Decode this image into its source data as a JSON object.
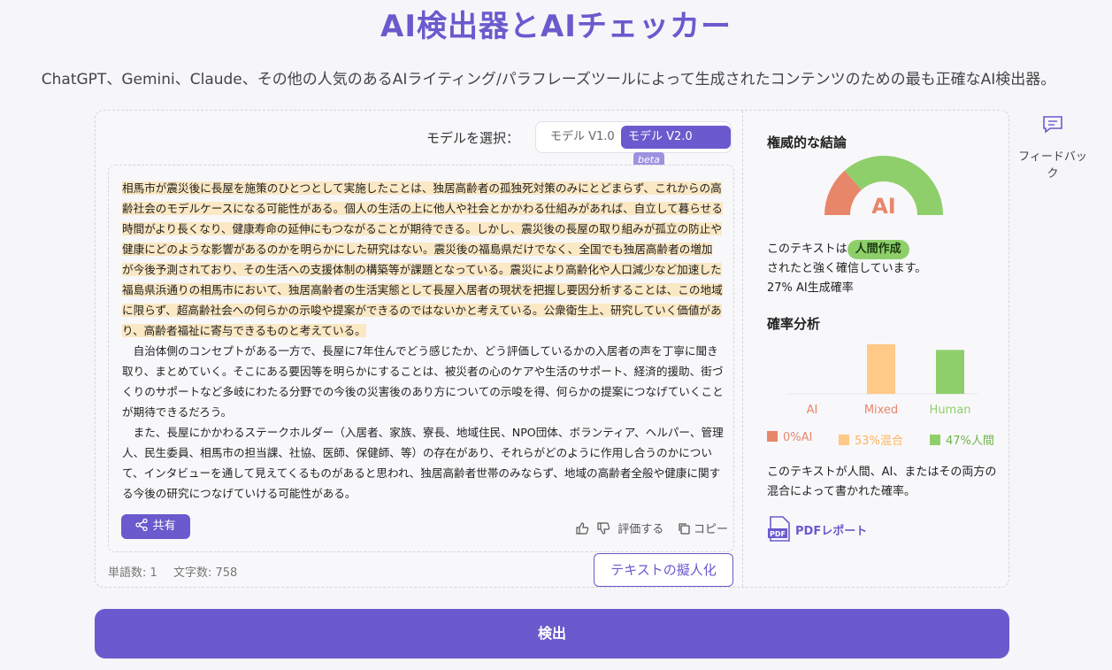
{
  "header": {
    "title": "AI検出器とAIチェッカー",
    "subtitle": "ChatGPT、Gemini、Claude、その他の人気のあるAIライティング/パラフレーズツールによって生成されたコンテンツのための最も正確なAI検出器。"
  },
  "model": {
    "label": "モデルを選択：",
    "options": [
      "モデル V1.0",
      "モデル V2.0"
    ],
    "selected": "モデル V2.0",
    "beta": "beta"
  },
  "text": {
    "paragraph1": "相馬市が震災後に長屋を施策のひとつとして実施したことは、独居高齢者の孤独死対策のみにとどまらず、これからの高齢社会のモデルケースになる可能性がある。個人の生活の上に他人や社会とかかわる仕組みがあれば、自立して暮らせる時間がより長くなり、健康寿命の延伸にもつながることが期待できる。しかし、震災後の長屋の取り組みが孤立の防止や健康にどのような影響があるのかを明らかにした研究はない。震災後の福島県だけでなく、全国でも独居高齢者の増加が今後予測されており、その生活への支援体制の構築等が課題となっている。震災により高齢化や人口減少など加速した福島県浜通りの相馬市において、独居高齢者の生活実態として長屋入居者の現状を把握し要因分析することは、この地域に限らず、超高齢社会への何らかの示唆や提案ができるのではないかと考えている。公衆衛生上、研究していく価値があり、高齢者福祉に寄与できるものと考えている。",
    "paragraph2": "自治体側のコンセプトがある一方で、長屋に7年住んでどう感じたか、どう評価しているかの入居者の声を丁寧に聞き取り、まとめていく。そこにある要因等を明らかにすることは、被災者の心のケアや生活のサポート、経済的援助、街づくりのサポートなど多岐にわたる分野での今後の災害後のあり方についての示唆を得、何らかの提案につなげていくことが期待できるだろう。",
    "paragraph3": "また、長屋にかかわるステークホルダー（入居者、家族、寮長、地域住民、NPO団体、ボランティア、ヘルパー、管理人、民生委員、相馬市の担当課、社協、医師、保健師、等）の存在があり、それらがどのように作用し合うのかについて、インタビューを通して見えてくるものがあると思われ、独居高齢者世帯のみならず、地域の高齢者全般や健康に関する今後の研究につなげていける可能性がある。"
  },
  "actions": {
    "share": "共有",
    "rate": "評価する",
    "copy": "コピー",
    "humanize": "テキストの擬人化",
    "detect": "検出"
  },
  "stats": {
    "words": "単語数: 1",
    "chars": "文字数: 758"
  },
  "result": {
    "section_title": "権威的な結論",
    "gauge_label": "AI",
    "verdict_prefix": "このテキストは",
    "verdict_badge": "人間作成",
    "verdict_suffix": "されたと強く確信しています。",
    "ai_rate": "27% AI生成確率",
    "analysis_title": "確率分析",
    "explain": "このテキストが人間、AI、またはその両方の混合によって書かれた確率。",
    "pdf": "PDFレポート",
    "feedback": "フィードバック"
  },
  "colors": {
    "accent": "#6a5acd",
    "ai": "#e8866a",
    "mixed": "#ffc987",
    "human": "#8fcf6b",
    "highlight": "#fbe8c4"
  },
  "chart_data": {
    "type": "bar",
    "categories": [
      "AI",
      "Mixed",
      "Human"
    ],
    "values": [
      0,
      53,
      47
    ],
    "legend": [
      "0%AI",
      "53%混合",
      "47%人間"
    ],
    "gauge": {
      "ai_share": 27,
      "human_share": 73
    }
  }
}
